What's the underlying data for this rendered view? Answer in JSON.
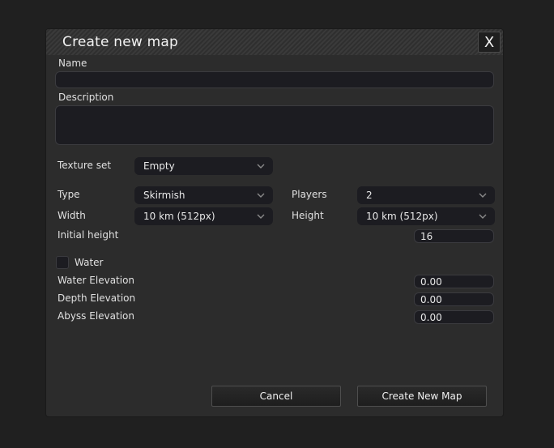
{
  "dialog": {
    "title": "Create new map",
    "close_label": "X"
  },
  "form": {
    "name_label": "Name",
    "name_value": "",
    "description_label": "Description",
    "description_value": "",
    "texture_set_label": "Texture set",
    "texture_set_value": "Empty",
    "type_label": "Type",
    "type_value": "Skirmish",
    "players_label": "Players",
    "players_value": "2",
    "width_label": "Width",
    "width_value": "10 km (512px)",
    "height_label": "Height",
    "height_value": "10 km (512px)",
    "initial_height_label": "Initial height",
    "initial_height_value": "16",
    "water_label": "Water",
    "water_checked": false,
    "water_elevation_label": "Water Elevation",
    "water_elevation_value": "0.00",
    "depth_elevation_label": "Depth Elevation",
    "depth_elevation_value": "0.00",
    "abyss_elevation_label": "Abyss Elevation",
    "abyss_elevation_value": "0.00"
  },
  "buttons": {
    "cancel_label": "Cancel",
    "create_label": "Create New Map"
  },
  "icons": {
    "dropdown": "chevron-down-icon",
    "close": "close-icon"
  },
  "colors": {
    "background": "#202020",
    "dialog": "#2c2c2c",
    "field": "#1c1c21",
    "text": "#e6e6e6"
  }
}
